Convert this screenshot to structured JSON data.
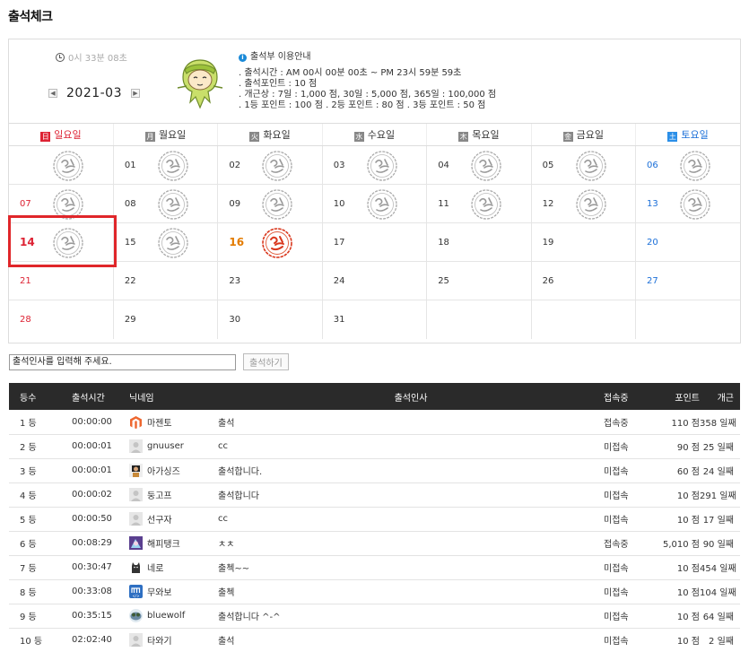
{
  "page_title": "출석체크",
  "timer": "0시 33분 08초",
  "month": {
    "label": "2021-03",
    "prev_icon": "prev-arrow",
    "next_icon": "next-arrow"
  },
  "guide": {
    "title": "출석부 이용안내",
    "lines": [
      ". 출석시간 : AM 00시 00분 00초 ~ PM 23시 59분 59초",
      ". 출석포인트 : 10 점",
      ". 개근상 : 7일 : 1,000 점,   30일 : 5,000 점,  365일 : 100,000 점",
      ". 1등 포인트 : 100 점   . 2등 포인트 : 80 점   . 3등 포인트 : 50 점"
    ]
  },
  "weekdays": [
    {
      "badge": "日",
      "label": "일요일"
    },
    {
      "badge": "月",
      "label": "월요일"
    },
    {
      "badge": "火",
      "label": "화요일"
    },
    {
      "badge": "水",
      "label": "수요일"
    },
    {
      "badge": "木",
      "label": "목요일"
    },
    {
      "badge": "金",
      "label": "금요일"
    },
    {
      "badge": "土",
      "label": "토요일"
    }
  ],
  "calendar": [
    [
      {
        "d": "",
        "s": 1
      },
      {
        "d": "01",
        "s": 1
      },
      {
        "d": "02",
        "s": 1
      },
      {
        "d": "03",
        "s": 1
      },
      {
        "d": "04",
        "s": 1
      },
      {
        "d": "05",
        "s": 1
      },
      {
        "d": "06",
        "s": 1
      }
    ],
    [
      {
        "d": "07",
        "s": 1
      },
      {
        "d": "08",
        "s": 1
      },
      {
        "d": "09",
        "s": 1
      },
      {
        "d": "10",
        "s": 1
      },
      {
        "d": "11",
        "s": 1
      },
      {
        "d": "12",
        "s": 1
      },
      {
        "d": "13",
        "s": 1
      }
    ],
    [
      {
        "d": "14",
        "s": 1
      },
      {
        "d": "15",
        "s": 1
      },
      {
        "d": "16",
        "s": 2
      },
      {
        "d": "17",
        "s": 0
      },
      {
        "d": "18",
        "s": 0
      },
      {
        "d": "19",
        "s": 0
      },
      {
        "d": "20",
        "s": 0
      }
    ],
    [
      {
        "d": "21",
        "s": 0
      },
      {
        "d": "22",
        "s": 0
      },
      {
        "d": "23",
        "s": 0
      },
      {
        "d": "24",
        "s": 0
      },
      {
        "d": "25",
        "s": 0
      },
      {
        "d": "26",
        "s": 0
      },
      {
        "d": "27",
        "s": 0
      }
    ],
    [
      {
        "d": "28",
        "s": 0
      },
      {
        "d": "29",
        "s": 0
      },
      {
        "d": "30",
        "s": 0
      },
      {
        "d": "31",
        "s": 0
      },
      {
        "d": "",
        "s": 0
      },
      {
        "d": "",
        "s": 0
      },
      {
        "d": "",
        "s": 0
      }
    ]
  ],
  "today": "16",
  "selected": "14",
  "greeting": {
    "placeholder": "출석인사를 입력해 주세요.",
    "button": "출석하기"
  },
  "ranking": {
    "headers": [
      "등수",
      "출석시간",
      "닉네임",
      "출석인사",
      "접속중",
      "포인트",
      "개근"
    ],
    "rows": [
      {
        "rank": "1 등",
        "time": "00:00:00",
        "avatar": "magento-logo",
        "nick": "마젠토",
        "msg": "출석",
        "status": "접속중",
        "point": "110 점",
        "days": "358 일째"
      },
      {
        "rank": "2 등",
        "time": "00:00:01",
        "avatar": "default-avatar",
        "nick": "gnuuser",
        "msg": "cc",
        "status": "미접속",
        "point": "90 점",
        "days": "25 일째"
      },
      {
        "rank": "3 등",
        "time": "00:00:01",
        "avatar": "person-avatar",
        "nick": "아가싱즈",
        "msg": "출석합니다.",
        "status": "미접속",
        "point": "60 점",
        "days": "24 일째"
      },
      {
        "rank": "4 등",
        "time": "00:00:02",
        "avatar": "default-avatar",
        "nick": "둥고프",
        "msg": "출석합니다",
        "status": "미접속",
        "point": "10 점",
        "days": "291 일째"
      },
      {
        "rank": "5 등",
        "time": "00:00:50",
        "avatar": "default-avatar",
        "nick": "선구자",
        "msg": "cc",
        "status": "미접속",
        "point": "10 점",
        "days": "17 일째"
      },
      {
        "rank": "6 등",
        "time": "00:08:29",
        "avatar": "anime-avatar",
        "nick": "해피탱크",
        "msg": "ㅊㅊ",
        "status": "접속중",
        "point": "5,010 점",
        "days": "90 일째"
      },
      {
        "rank": "7 등",
        "time": "00:30:47",
        "avatar": "cat-avatar",
        "nick": "네로",
        "msg": "출첵~~",
        "status": "미접속",
        "point": "10 점",
        "days": "454 일째"
      },
      {
        "rank": "8 등",
        "time": "00:33:08",
        "avatar": "code-logo",
        "nick": "무와보",
        "msg": "출첵",
        "status": "미접속",
        "point": "10 점",
        "days": "104 일째"
      },
      {
        "rank": "9 등",
        "time": "00:35:15",
        "avatar": "wolf-avatar",
        "nick": "bluewolf",
        "msg": "출석합니다 ^-^",
        "status": "미접속",
        "point": "10 점",
        "days": "64 일째"
      },
      {
        "rank": "10 등",
        "time": "02:02:40",
        "avatar": "default-avatar",
        "nick": "타와기",
        "msg": "출석",
        "status": "미접속",
        "point": "10 점",
        "days": "2 일째"
      }
    ]
  },
  "colors": {
    "sunday": "#dd2233",
    "saturday": "#1b6fd8",
    "today": "#e37b00",
    "header_bg": "#2a2a2a",
    "stamp_done": "#aaaaaa",
    "stamp_today": "#d9381e",
    "selection": "#e0262a"
  }
}
